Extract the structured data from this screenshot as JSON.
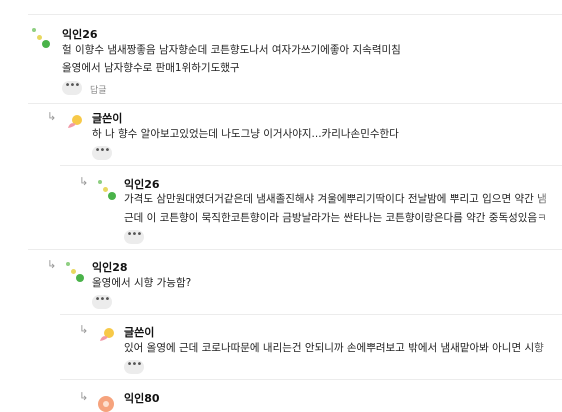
{
  "comments": [
    {
      "nickname": "익인26",
      "lines": [
        "헐 이향수 냄새짱좋음 남자향순데 코튼향도나서 여자가쓰기에좋아 지속력미침",
        "올영에서 남자향수로 판매1위하기도했구"
      ],
      "reply_label": "답글"
    },
    {
      "nickname": "글쓴이",
      "lines": [
        "하 나 향수 알아보고있었는데 나도그냥 이거사야지...카리나손민수한다"
      ]
    },
    {
      "nickname": "익인26",
      "lines": [
        "가격도 삼만원대였더거같은데 냄새졸진해샤 겨울에뿌리기딱이다 전날밤에 뿌리고 입으면 약간 냄",
        "근데 이 코튼향이 묵직한코튼향이라 금방날라가는 싼타나는 코튼향이랑은다름 약간 중독성있음ㅋ"
      ]
    },
    {
      "nickname": "익인28",
      "lines": [
        "올영에서 시향 가능함?"
      ]
    },
    {
      "nickname": "글쓴이",
      "lines": [
        "있어 올영에 근데 코로나따문에 내리는건 안되니까 손에뿌려보고 밖에서 냄새맡아봐 아니면 시향"
      ]
    },
    {
      "nickname": "익인80",
      "lines": []
    }
  ],
  "more_label": "•••",
  "reply_arrow": "↳",
  "colors": {
    "dot_green": "#5fb85a",
    "dot_yellow": "#e8d860",
    "author_yellow": "#f7c948",
    "author_pink": "#f29aa8",
    "avatar_orange": "#f6a37d"
  }
}
